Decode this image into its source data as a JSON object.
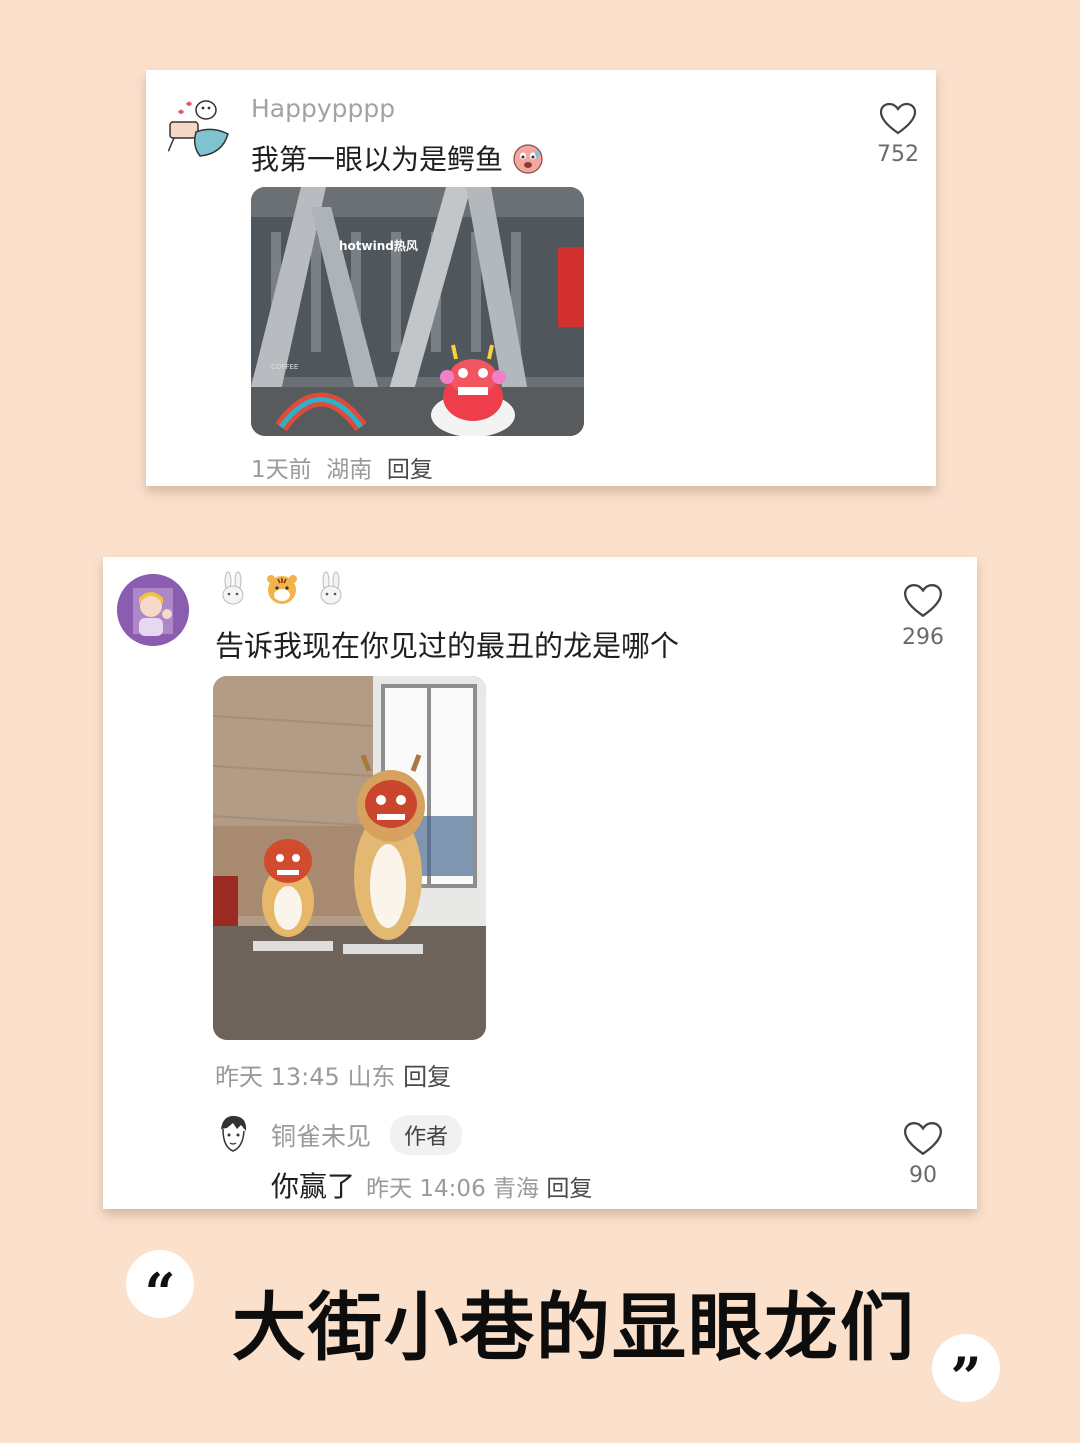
{
  "comment1": {
    "username": "Happypppp",
    "text": "我第一眼以为是鳄鱼",
    "emoji_icon": "tearful-face-icon",
    "like_count": "752",
    "meta": {
      "time": "1天前",
      "location": "湖南",
      "reply": "回复"
    },
    "photo_sign": "hotwind热风",
    "photo_small_text": "COFFEE"
  },
  "comment2": {
    "badges": [
      "rabbit-icon",
      "tiger-icon",
      "rabbit-icon"
    ],
    "text": "告诉我现在你见过的最丑的龙是哪个",
    "like_count": "296",
    "meta": {
      "time": "昨天 13:45",
      "location": "山东",
      "reply": "回复"
    }
  },
  "reply": {
    "username": "铜雀未见",
    "author_tag": "作者",
    "text": "你赢了",
    "meta": {
      "time": "昨天 14:06",
      "location": "青海",
      "reply": "回复"
    },
    "like_count": "90"
  },
  "headline": "大街小巷的显眼龙们",
  "quotes": {
    "open": "“",
    "close": "”"
  },
  "colors": {
    "background": "#fbe0cc",
    "card": "#ffffff",
    "muted_text": "#9a9a9a"
  }
}
